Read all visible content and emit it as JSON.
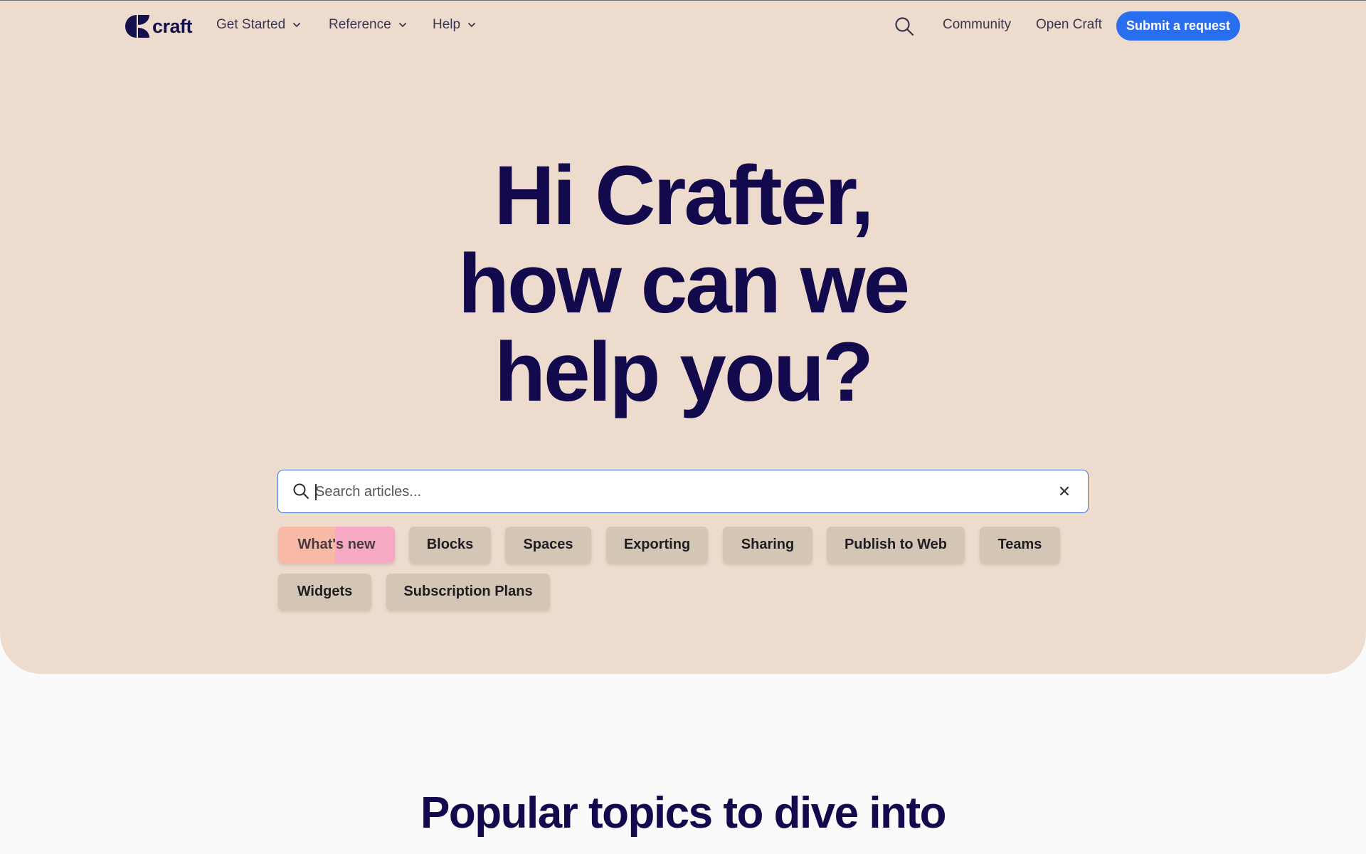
{
  "brand": {
    "name": "craft"
  },
  "nav": {
    "items": [
      {
        "label": "Get Started",
        "has_dropdown": true
      },
      {
        "label": "Reference",
        "has_dropdown": true
      },
      {
        "label": "Help",
        "has_dropdown": true
      }
    ],
    "search_icon": "search-icon",
    "right_links": [
      {
        "label": "Community"
      },
      {
        "label": "Open Craft"
      }
    ],
    "cta_label": "Submit a request",
    "cta_color": "#2a6ef0"
  },
  "hero": {
    "headline_lines": [
      "Hi Crafter,",
      "how can we",
      "help you?"
    ],
    "background": "#eddccd"
  },
  "search": {
    "placeholder": "Search articles...",
    "value": "",
    "clear_icon": "close-icon"
  },
  "topics": [
    {
      "label": "What's new"
    },
    {
      "label": "Blocks"
    },
    {
      "label": "Spaces"
    },
    {
      "label": "Exporting"
    },
    {
      "label": "Sharing"
    },
    {
      "label": "Publish to Web"
    },
    {
      "label": "Teams"
    },
    {
      "label": "Widgets"
    },
    {
      "label": "Subscription Plans"
    }
  ],
  "popular": {
    "title": "Popular topics to dive into"
  }
}
